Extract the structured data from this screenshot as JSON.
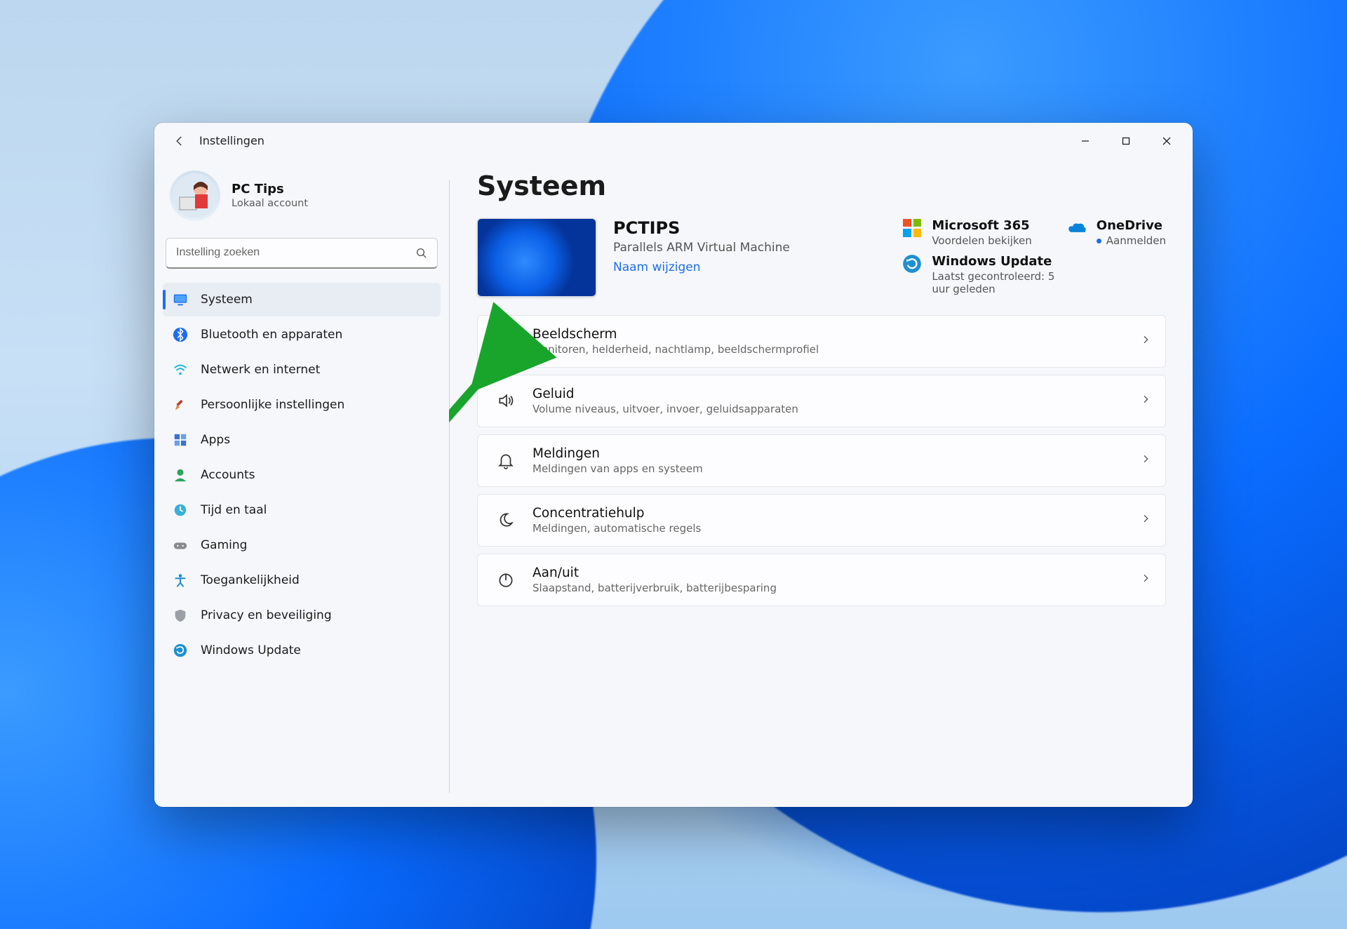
{
  "window": {
    "title": "Instellingen"
  },
  "profile": {
    "name": "PC Tips",
    "subtitle": "Lokaal account"
  },
  "search": {
    "placeholder": "Instelling zoeken"
  },
  "sidebar": {
    "items": [
      {
        "label": "Systeem",
        "icon": "system",
        "active": true
      },
      {
        "label": "Bluetooth en apparaten",
        "icon": "bluetooth"
      },
      {
        "label": "Netwerk en internet",
        "icon": "network"
      },
      {
        "label": "Persoonlijke instellingen",
        "icon": "personalization"
      },
      {
        "label": "Apps",
        "icon": "apps"
      },
      {
        "label": "Accounts",
        "icon": "accounts"
      },
      {
        "label": "Tijd en taal",
        "icon": "time"
      },
      {
        "label": "Gaming",
        "icon": "gaming"
      },
      {
        "label": "Toegankelijkheid",
        "icon": "accessibility"
      },
      {
        "label": "Privacy en beveiliging",
        "icon": "privacy"
      },
      {
        "label": "Windows Update",
        "icon": "update"
      }
    ]
  },
  "page": {
    "heading": "Systeem"
  },
  "device": {
    "name": "PCTIPS",
    "model": "Parallels ARM Virtual Machine",
    "rename": "Naam wijzigen"
  },
  "services": {
    "m365": {
      "title": "Microsoft 365",
      "sub": "Voordelen bekijken"
    },
    "onedrive": {
      "title": "OneDrive",
      "sub": "Aanmelden"
    },
    "wu": {
      "title": "Windows Update",
      "sub": "Laatst gecontroleerd: 5 uur geleden"
    }
  },
  "cards": [
    {
      "title": "Beeldscherm",
      "sub": "Monitoren, helderheid, nachtlamp, beeldschermprofiel",
      "icon": "display"
    },
    {
      "title": "Geluid",
      "sub": "Volume niveaus, uitvoer, invoer, geluidsapparaten",
      "icon": "sound"
    },
    {
      "title": "Meldingen",
      "sub": "Meldingen van apps en systeem",
      "icon": "bell"
    },
    {
      "title": "Concentratiehulp",
      "sub": "Meldingen, automatische regels",
      "icon": "moon"
    },
    {
      "title": "Aan/uit",
      "sub": "Slaapstand, batterijverbruik, batterijbesparing",
      "icon": "power"
    }
  ]
}
